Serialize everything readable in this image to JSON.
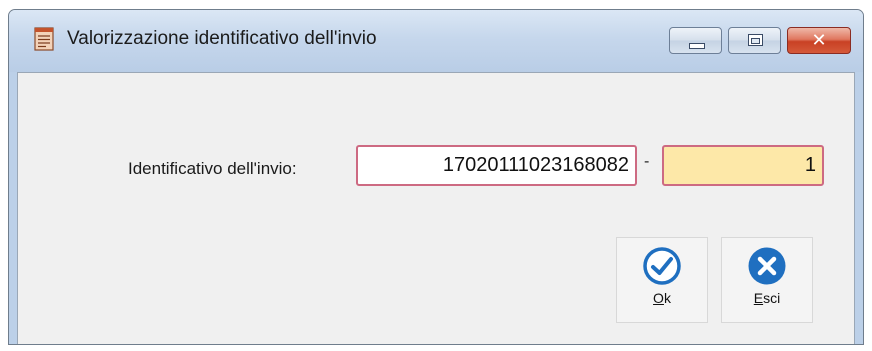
{
  "window": {
    "title": "Valorizzazione identificativo dell'invio"
  },
  "form": {
    "label": "Identificativo dell'invio:",
    "identificativo_value": "17020111023168082",
    "separator": "-",
    "progressivo_value": "1"
  },
  "buttons": {
    "ok": {
      "mnemonic": "O",
      "rest": "k",
      "icon": "checkmark-circle-icon"
    },
    "esci": {
      "mnemonic": "E",
      "rest": "sci",
      "icon": "x-circle-icon"
    }
  },
  "colors": {
    "field_highlight": "#fde8a8",
    "field_border": "#cd6a82",
    "accent_blue": "#1f6fc0"
  }
}
